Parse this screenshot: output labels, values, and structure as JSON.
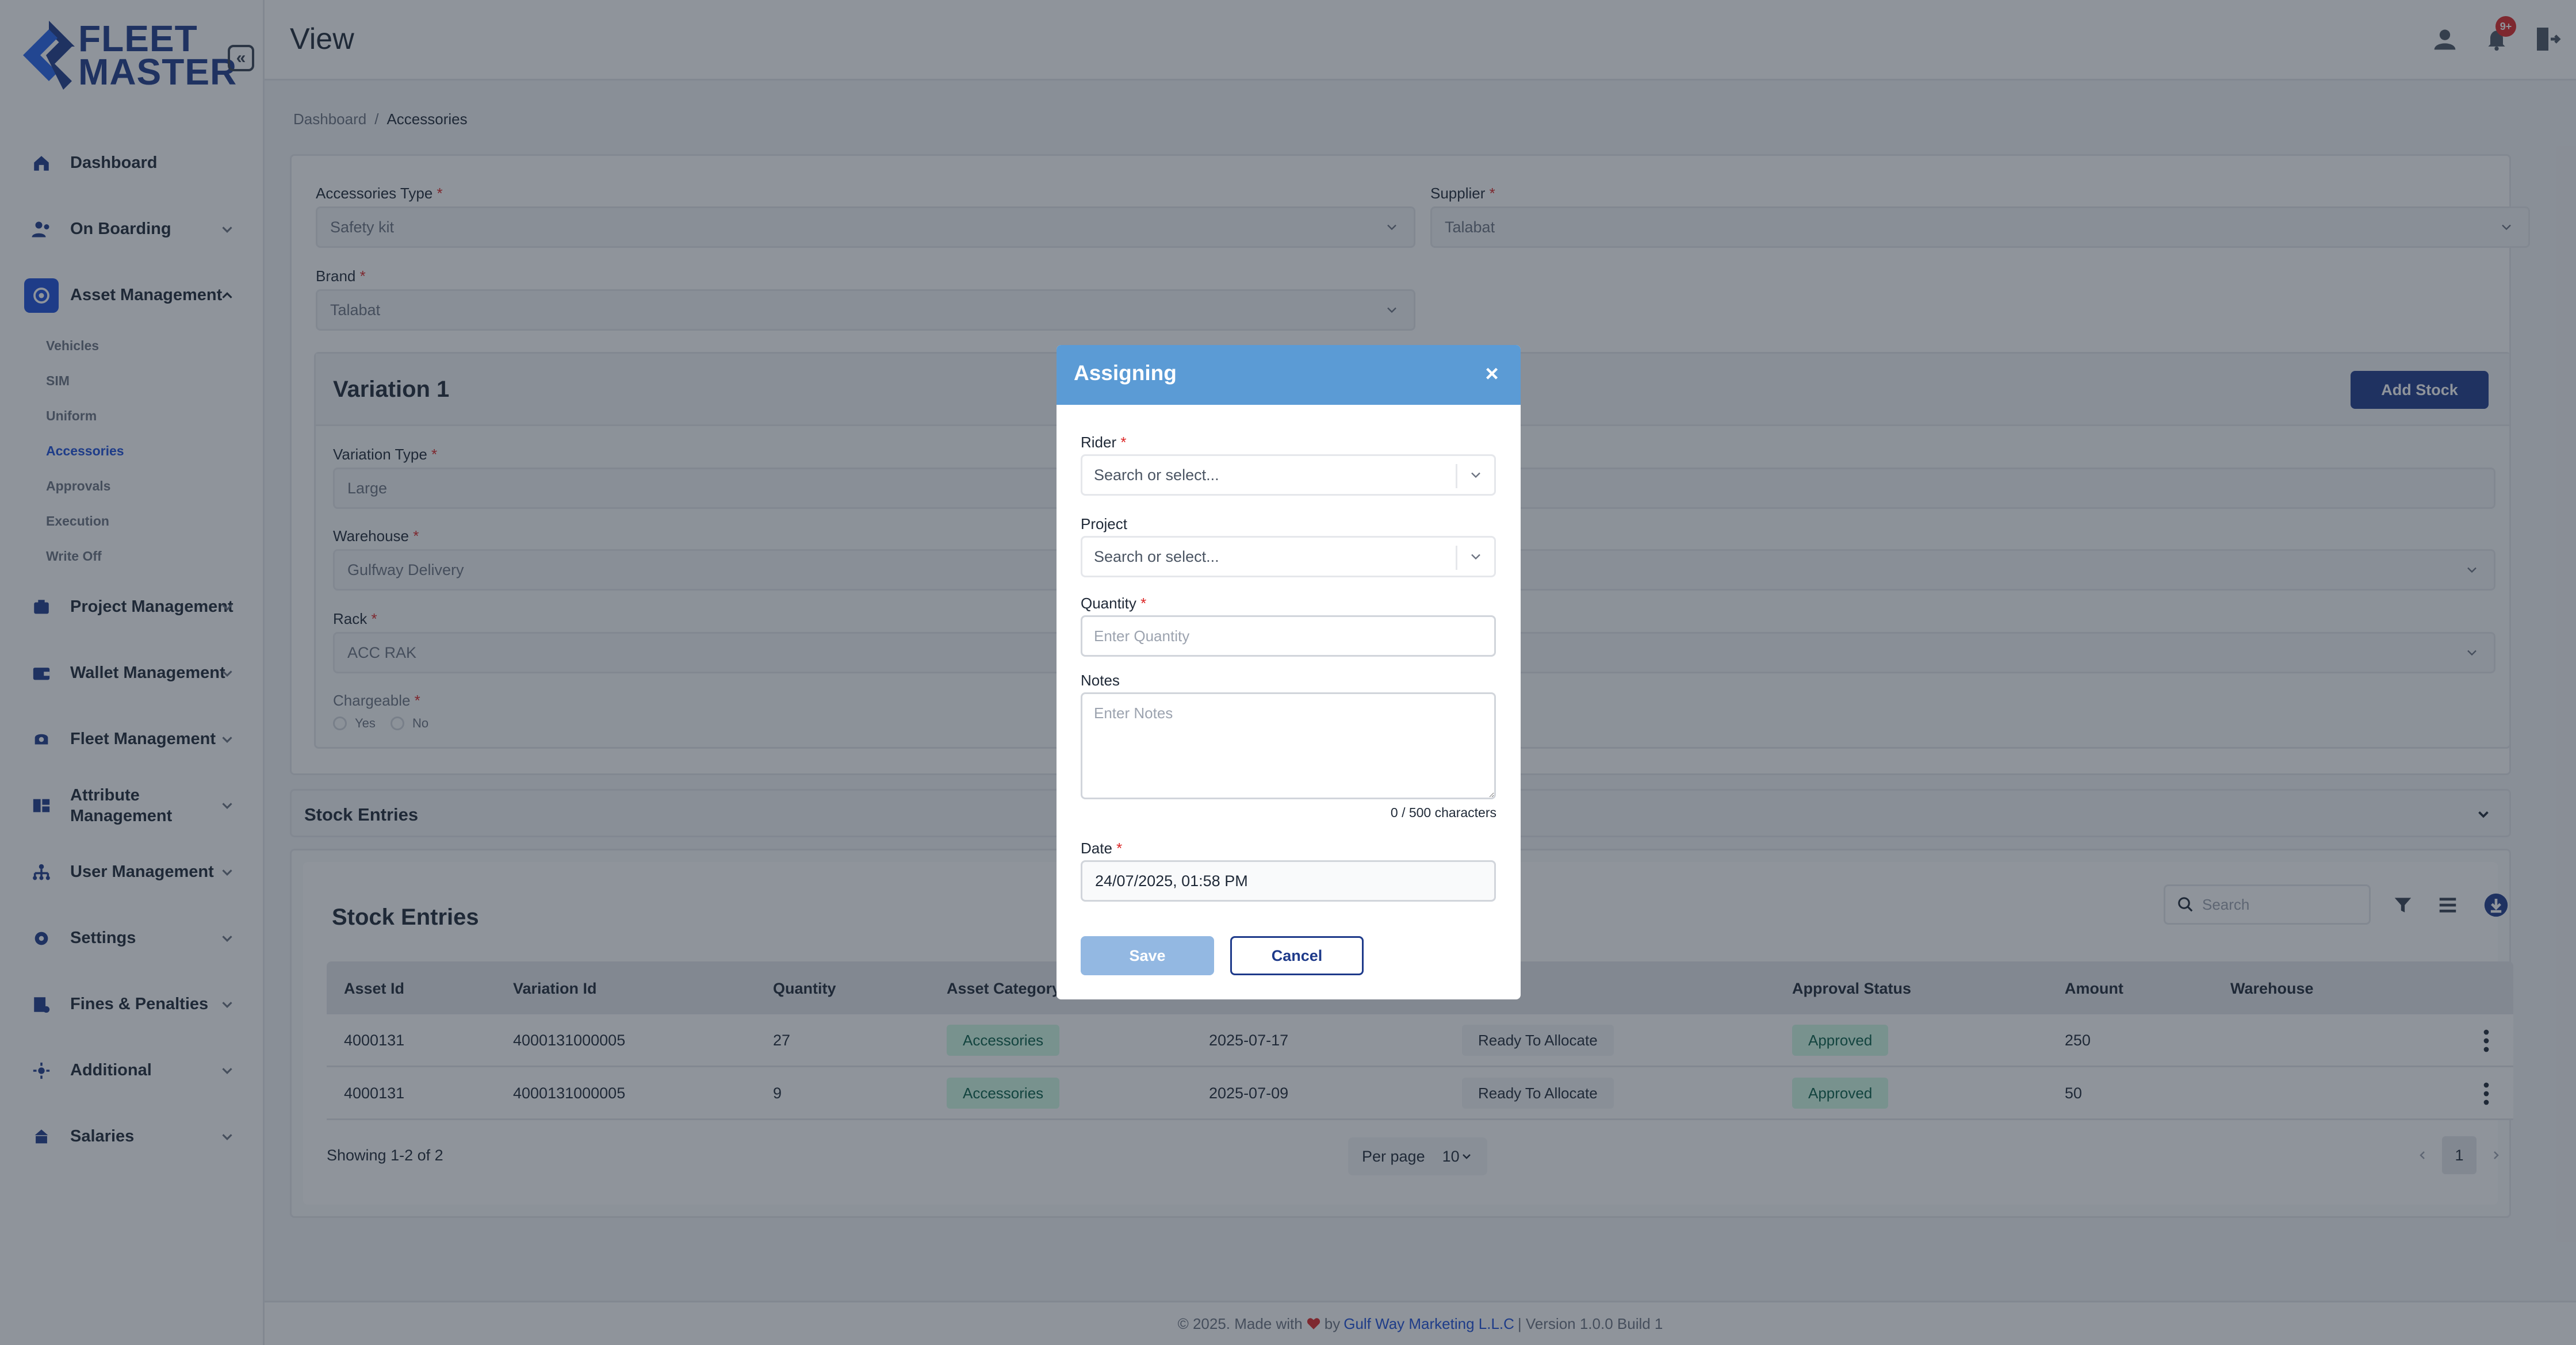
{
  "app": {
    "logo_line1": "FLEET",
    "logo_line2": "MASTER",
    "collapse_label": "«"
  },
  "sidebar": {
    "items": [
      {
        "label": "Dashboard",
        "icon": "home-icon"
      },
      {
        "label": "On Boarding",
        "icon": "users-icon"
      },
      {
        "label": "Asset Management",
        "icon": "asset-icon"
      },
      {
        "label": "Project Management",
        "icon": "project-icon"
      },
      {
        "label": "Wallet Management",
        "icon": "wallet-icon"
      },
      {
        "label": "Fleet Management",
        "icon": "fleet-icon"
      },
      {
        "label": "Attribute Management",
        "icon": "attribute-icon"
      },
      {
        "label": "User Management",
        "icon": "user-tree-icon"
      },
      {
        "label": "Settings",
        "icon": "gear-icon"
      },
      {
        "label": "Fines & Penalties",
        "icon": "fines-icon"
      },
      {
        "label": "Additional",
        "icon": "additional-icon"
      },
      {
        "label": "Salaries",
        "icon": "salaries-icon"
      }
    ],
    "sub_items": [
      "Vehicles",
      "SIM",
      "Uniform",
      "Accessories",
      "Approvals",
      "Execution",
      "Write Off"
    ]
  },
  "header": {
    "title": "View",
    "notif_count": "9+"
  },
  "breadcrumb": {
    "home": "Dashboard",
    "sep": "/",
    "current": "Accessories"
  },
  "form": {
    "accessories_type_label": "Accessories Type",
    "accessories_type_value": "Safety kit",
    "supplier_label": "Supplier",
    "supplier_value": "Talabat",
    "brand_label": "Brand",
    "brand_value": "Talabat",
    "required_mark": "*"
  },
  "variation": {
    "title": "Variation 1",
    "add_stock": "Add Stock",
    "variation_type_label": "Variation Type",
    "variation_type_value": "Large",
    "warehouse_label": "Warehouse",
    "warehouse_value": "Gulfway Delivery",
    "rack_label": "Rack",
    "rack_value": "ACC RAK",
    "chargeable_label": "Chargeable",
    "yes": "Yes",
    "no": "No"
  },
  "stock": {
    "accordion_title": "Stock Entries",
    "table_title": "Stock Entries",
    "search_placeholder": "Search",
    "columns": [
      "Asset Id",
      "Variation Id",
      "Quantity",
      "Asset Category",
      "Approval Status",
      "Amount",
      "Warehouse"
    ],
    "rows": [
      {
        "asset_id": "4000131",
        "variation_id": "4000131000005",
        "quantity": "27",
        "category": "Accessories",
        "date": "2025-07-17",
        "status": "Ready To Allocate",
        "approval": "Approved",
        "amount": "250"
      },
      {
        "asset_id": "4000131",
        "variation_id": "4000131000005",
        "quantity": "9",
        "category": "Accessories",
        "date": "2025-07-09",
        "status": "Ready To Allocate",
        "approval": "Approved",
        "amount": "50"
      }
    ],
    "showing": "Showing 1-2 of 2",
    "per_page_label": "Per page",
    "per_page_value": "10",
    "current_page": "1"
  },
  "footer": {
    "prefix": "© 2025. Made with",
    "by": "by",
    "brand": "Gulf Way Marketing L.L.C",
    "suffix": "| Version 1.0.0 Build 1"
  },
  "modal": {
    "title": "Assigning",
    "close": "×",
    "rider_label": "Rider",
    "rider_placeholder": "Search or select...",
    "project_label": "Project",
    "project_placeholder": "Search or select...",
    "quantity_label": "Quantity",
    "quantity_placeholder": "Enter Quantity",
    "notes_label": "Notes",
    "notes_placeholder": "Enter Notes",
    "char_count": "0 / 500 characters",
    "date_label": "Date",
    "date_value": "24/07/2025, 01:58 PM",
    "save": "Save",
    "cancel": "Cancel"
  },
  "colors": {
    "brand_blue": "#1e3a8a",
    "modal_header": "#5b9bd5",
    "approved_bg": "#d1fae5",
    "danger": "#dc2626"
  }
}
